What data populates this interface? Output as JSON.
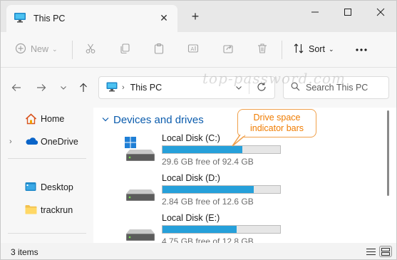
{
  "tab": {
    "title": "This PC",
    "close_icon": "close-icon",
    "pc_icon": "monitor-icon"
  },
  "new_tab": {
    "label": "+"
  },
  "window_controls": {
    "minimize": "minimize-icon",
    "maximize": "maximize-icon",
    "close": "close-icon"
  },
  "command_bar": {
    "new_label": "New",
    "sort_label": "Sort",
    "icons": [
      "cut-icon",
      "copy-icon",
      "paste-icon",
      "rename-icon",
      "share-icon",
      "delete-icon",
      "more-icon"
    ]
  },
  "address": {
    "crumb": "This PC",
    "search_placeholder": "Search This PC",
    "watermark": "top-password.com"
  },
  "nav_pane": {
    "items": [
      {
        "label": "Home",
        "icon": "home-icon",
        "expandable": false
      },
      {
        "label": "OneDrive",
        "icon": "onedrive-icon",
        "expandable": true
      },
      {
        "label": "Desktop",
        "icon": "desktop-icon",
        "expandable": false
      },
      {
        "label": "trackrun",
        "icon": "folder-icon",
        "expandable": false
      }
    ]
  },
  "content": {
    "group_title": "Devices and drives",
    "drives": [
      {
        "name": "Local Disk (C:)",
        "free_text": "29.6 GB free of 92.4 GB",
        "used_fraction": 0.68,
        "system": true
      },
      {
        "name": "Local Disk (D:)",
        "free_text": "2.84 GB free of 12.6 GB",
        "used_fraction": 0.775,
        "system": false
      },
      {
        "name": "Local Disk (E:)",
        "free_text": "4.75 GB free of 12.8 GB",
        "used_fraction": 0.629,
        "system": false
      }
    ]
  },
  "callout": {
    "line1": "Drive space",
    "line2": "indicator bars"
  },
  "status_bar": {
    "item_count": "3 items"
  },
  "colors": {
    "accent": "#26a0da",
    "link": "#0b5cad",
    "callout": "#f07c00"
  }
}
